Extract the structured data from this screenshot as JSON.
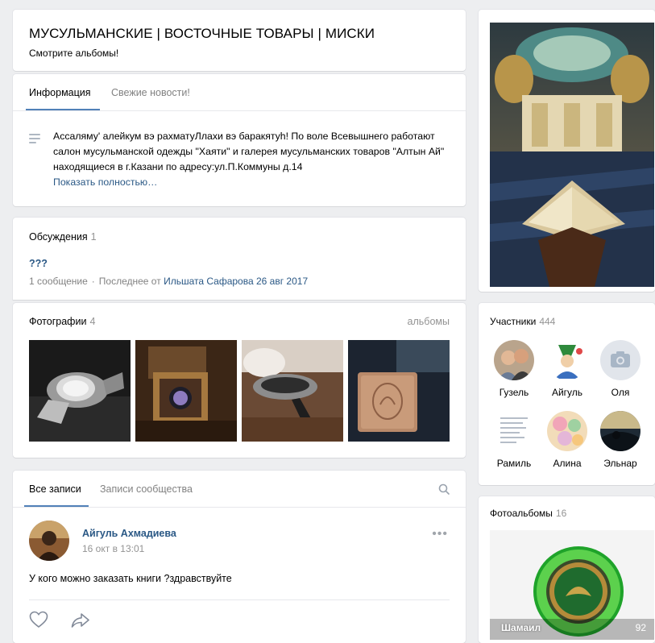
{
  "header": {
    "title": "МУСУЛЬМАНСКИЕ | ВОСТОЧНЫЕ ТОВАРЫ | МИСКИ",
    "subtitle": "Смотрите альбомы!"
  },
  "info": {
    "tabs": [
      {
        "label": "Информация",
        "active": true
      },
      {
        "label": "Свежие новости!",
        "active": false
      }
    ],
    "text": "Ассаляму' алейкум вэ рахматуЛлахи вэ баракятуh! По воле Всевышнего работают салон мусульманской одежды \"Хаяти\" и галерея мусульманских товаров \"Алтын Ай\" находящиеся в г.Казани по адресу:ул.П.Коммуны д.14",
    "more": "Показать полностью…",
    "icon": "text-lines-icon"
  },
  "discussions": {
    "title": "Обсуждения",
    "count": "1",
    "topic": "???",
    "messages": "1 сообщение",
    "last_prefix": "Последнее от",
    "last_author": "Ильшата Сафарова",
    "last_date": "26 авг 2017"
  },
  "photos": {
    "title": "Фотографии",
    "count": "4",
    "link": "альбомы"
  },
  "wall": {
    "tabs": [
      {
        "label": "Все записи",
        "active": true
      },
      {
        "label": "Записи сообщества",
        "active": false
      }
    ],
    "post": {
      "author": "Айгуль Ахмадиева",
      "date": "16 окт в 13:01",
      "text": "У кого можно заказать книги ?здравствуйте",
      "menu": "•••"
    }
  },
  "members": {
    "title": "Участники",
    "count": "444",
    "list": [
      {
        "name": "Гузель"
      },
      {
        "name": "Айгуль"
      },
      {
        "name": "Оля"
      },
      {
        "name": "Рамиль"
      },
      {
        "name": "Алина"
      },
      {
        "name": "Эльнар"
      }
    ]
  },
  "albums": {
    "title": "Фотоальбомы",
    "count": "16",
    "album_name": "Шамаил",
    "album_count": "92"
  },
  "colors": {
    "accent": "#5181b8",
    "link": "#2a5885",
    "background": "#edeef0",
    "muted": "#939393"
  }
}
